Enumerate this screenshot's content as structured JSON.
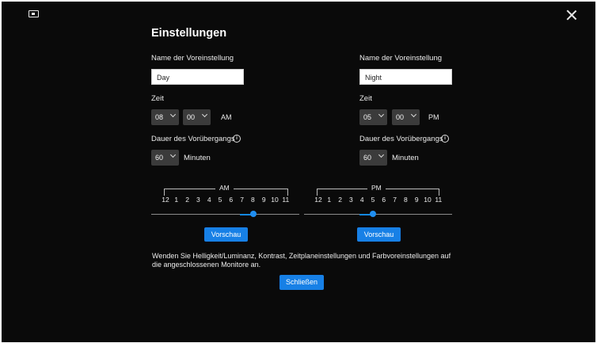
{
  "title": "Einstellungen",
  "icons": {
    "display": "monitor-icon",
    "close": "close-icon",
    "info": "info-icon",
    "chevron": "chevron-down-icon"
  },
  "left": {
    "preset_label": "Name der Voreinstellung",
    "preset_value": "Day",
    "time_label": "Zeit",
    "hour": "08",
    "minute": "00",
    "period": "AM",
    "duration_label": "Dauer des Vorübergangs",
    "duration_value": "60",
    "duration_unit": "Minuten",
    "scale_label": "AM",
    "ticks": [
      "12",
      "1",
      "2",
      "3",
      "4",
      "5",
      "6",
      "7",
      "8",
      "9",
      "10",
      "11"
    ],
    "slider_value": 8,
    "preview_label": "Vorschau"
  },
  "right": {
    "preset_label": "Name der Voreinstellung",
    "preset_value": "Night",
    "time_label": "Zeit",
    "hour": "05",
    "minute": "00",
    "period": "PM",
    "duration_label": "Dauer des Vorübergangs",
    "duration_value": "60",
    "duration_unit": "Minuten",
    "scale_label": "PM",
    "ticks": [
      "12",
      "1",
      "2",
      "3",
      "4",
      "5",
      "6",
      "7",
      "8",
      "9",
      "10",
      "11"
    ],
    "slider_value": 5,
    "preview_label": "Vorschau"
  },
  "message": "Wenden Sie Helligkeit/Luminanz, Kontrast, Zeitplaneinstellungen und Farbvoreinstellungen auf die angeschlossenen Monitore an.",
  "close_label": "Schließen",
  "colors": {
    "accent": "#1780e6",
    "background": "#0a0a0a",
    "dropdown": "#3b3b3b"
  }
}
